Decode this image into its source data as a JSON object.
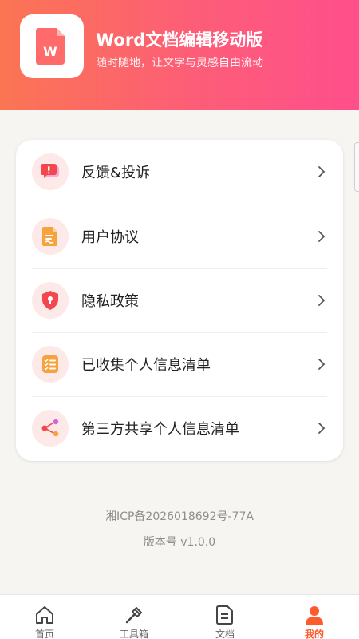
{
  "header": {
    "title": "Word文档编辑移动版",
    "subtitle": "随时随地，让文字与灵感自由流动",
    "logo_letter": "W"
  },
  "menu": {
    "items": [
      {
        "label": "反馈&投诉",
        "icon": "feedback-icon"
      },
      {
        "label": "用户协议",
        "icon": "document-icon"
      },
      {
        "label": "隐私政策",
        "icon": "shield-icon"
      },
      {
        "label": "已收集个人信息清单",
        "icon": "checklist-icon"
      },
      {
        "label": "第三方共享个人信息清单",
        "icon": "share-icon"
      }
    ]
  },
  "footer": {
    "icp": "湘ICP备2026018692号-77A",
    "version": "版本号 v1.0.0"
  },
  "tabbar": {
    "tabs": [
      {
        "label": "首页",
        "icon": "home-icon"
      },
      {
        "label": "工具箱",
        "icon": "hammer-icon"
      },
      {
        "label": "文档",
        "icon": "document-icon"
      },
      {
        "label": "我的",
        "icon": "user-icon"
      }
    ],
    "active": "我的"
  },
  "colors": {
    "accent": "#ff5a2c",
    "header_start": "#fb7553",
    "header_end": "#ff4f8c",
    "icon_bg": "#fde9e7"
  }
}
